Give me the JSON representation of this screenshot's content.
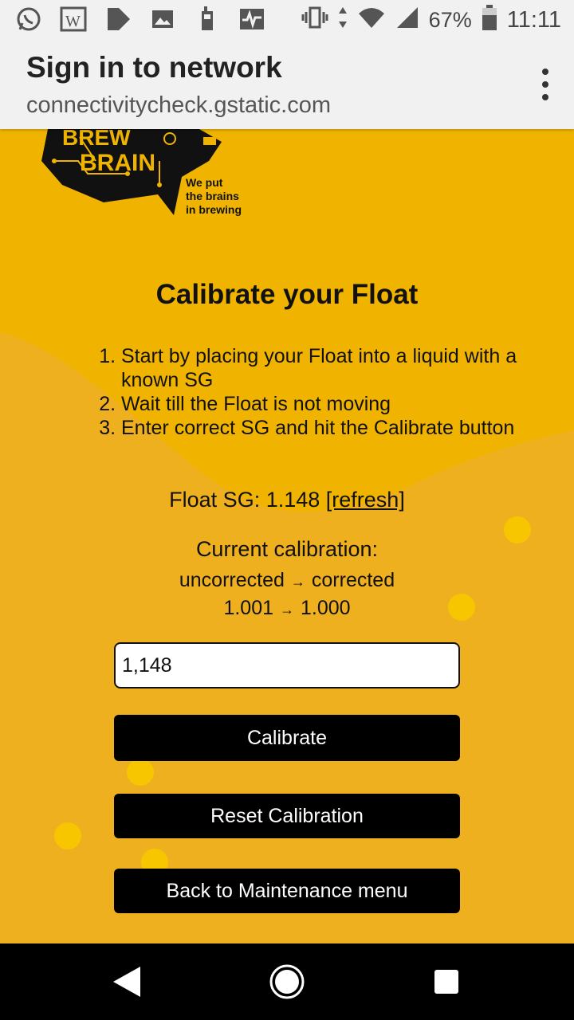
{
  "status_bar": {
    "battery": "67%",
    "time": "11:11"
  },
  "appbar": {
    "title": "Sign in to network",
    "url": "connectivitycheck.gstatic.com"
  },
  "logo": {
    "word1": "BREW",
    "word2": "BRAIN",
    "tagline1": "We put",
    "tagline2": "the brains",
    "tagline3": "in brewing"
  },
  "page": {
    "heading": "Calibrate your Float",
    "steps": [
      "Start by placing your Float into a liquid with a known SG",
      "Wait till the Float is not moving",
      "Enter correct SG and hit the Calibrate button"
    ],
    "float_sg_label": "Float SG: 1.148",
    "refresh_link": "[refresh]",
    "current_calibration_label": "Current calibration:",
    "cal_header_left": "uncorrected",
    "cal_header_right": "corrected",
    "cal_arrow": "→",
    "cal_value_left": "1.001",
    "cal_value_right": "1.000",
    "sg_input_value": "1,148",
    "calibrate_button": "Calibrate",
    "reset_button": "Reset Calibration",
    "back_button": "Back to Maintenance menu"
  },
  "colors": {
    "page_bg": "#efb020",
    "upper_bg": "#f0b400",
    "dot": "#f7c600",
    "button_bg": "#000000"
  }
}
